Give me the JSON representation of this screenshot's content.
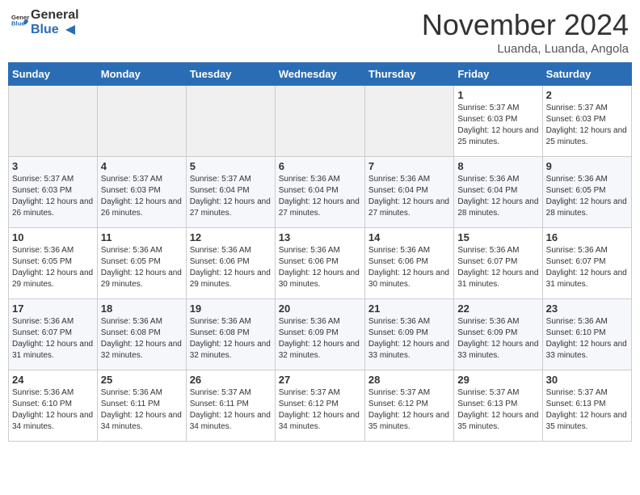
{
  "header": {
    "logo_general": "General",
    "logo_blue": "Blue",
    "month": "November 2024",
    "location": "Luanda, Luanda, Angola"
  },
  "days_of_week": [
    "Sunday",
    "Monday",
    "Tuesday",
    "Wednesday",
    "Thursday",
    "Friday",
    "Saturday"
  ],
  "weeks": [
    [
      {
        "day": "",
        "info": ""
      },
      {
        "day": "",
        "info": ""
      },
      {
        "day": "",
        "info": ""
      },
      {
        "day": "",
        "info": ""
      },
      {
        "day": "",
        "info": ""
      },
      {
        "day": "1",
        "info": "Sunrise: 5:37 AM\nSunset: 6:03 PM\nDaylight: 12 hours and 25 minutes."
      },
      {
        "day": "2",
        "info": "Sunrise: 5:37 AM\nSunset: 6:03 PM\nDaylight: 12 hours and 25 minutes."
      }
    ],
    [
      {
        "day": "3",
        "info": "Sunrise: 5:37 AM\nSunset: 6:03 PM\nDaylight: 12 hours and 26 minutes."
      },
      {
        "day": "4",
        "info": "Sunrise: 5:37 AM\nSunset: 6:03 PM\nDaylight: 12 hours and 26 minutes."
      },
      {
        "day": "5",
        "info": "Sunrise: 5:37 AM\nSunset: 6:04 PM\nDaylight: 12 hours and 27 minutes."
      },
      {
        "day": "6",
        "info": "Sunrise: 5:36 AM\nSunset: 6:04 PM\nDaylight: 12 hours and 27 minutes."
      },
      {
        "day": "7",
        "info": "Sunrise: 5:36 AM\nSunset: 6:04 PM\nDaylight: 12 hours and 27 minutes."
      },
      {
        "day": "8",
        "info": "Sunrise: 5:36 AM\nSunset: 6:04 PM\nDaylight: 12 hours and 28 minutes."
      },
      {
        "day": "9",
        "info": "Sunrise: 5:36 AM\nSunset: 6:05 PM\nDaylight: 12 hours and 28 minutes."
      }
    ],
    [
      {
        "day": "10",
        "info": "Sunrise: 5:36 AM\nSunset: 6:05 PM\nDaylight: 12 hours and 29 minutes."
      },
      {
        "day": "11",
        "info": "Sunrise: 5:36 AM\nSunset: 6:05 PM\nDaylight: 12 hours and 29 minutes."
      },
      {
        "day": "12",
        "info": "Sunrise: 5:36 AM\nSunset: 6:06 PM\nDaylight: 12 hours and 29 minutes."
      },
      {
        "day": "13",
        "info": "Sunrise: 5:36 AM\nSunset: 6:06 PM\nDaylight: 12 hours and 30 minutes."
      },
      {
        "day": "14",
        "info": "Sunrise: 5:36 AM\nSunset: 6:06 PM\nDaylight: 12 hours and 30 minutes."
      },
      {
        "day": "15",
        "info": "Sunrise: 5:36 AM\nSunset: 6:07 PM\nDaylight: 12 hours and 31 minutes."
      },
      {
        "day": "16",
        "info": "Sunrise: 5:36 AM\nSunset: 6:07 PM\nDaylight: 12 hours and 31 minutes."
      }
    ],
    [
      {
        "day": "17",
        "info": "Sunrise: 5:36 AM\nSunset: 6:07 PM\nDaylight: 12 hours and 31 minutes."
      },
      {
        "day": "18",
        "info": "Sunrise: 5:36 AM\nSunset: 6:08 PM\nDaylight: 12 hours and 32 minutes."
      },
      {
        "day": "19",
        "info": "Sunrise: 5:36 AM\nSunset: 6:08 PM\nDaylight: 12 hours and 32 minutes."
      },
      {
        "day": "20",
        "info": "Sunrise: 5:36 AM\nSunset: 6:09 PM\nDaylight: 12 hours and 32 minutes."
      },
      {
        "day": "21",
        "info": "Sunrise: 5:36 AM\nSunset: 6:09 PM\nDaylight: 12 hours and 33 minutes."
      },
      {
        "day": "22",
        "info": "Sunrise: 5:36 AM\nSunset: 6:09 PM\nDaylight: 12 hours and 33 minutes."
      },
      {
        "day": "23",
        "info": "Sunrise: 5:36 AM\nSunset: 6:10 PM\nDaylight: 12 hours and 33 minutes."
      }
    ],
    [
      {
        "day": "24",
        "info": "Sunrise: 5:36 AM\nSunset: 6:10 PM\nDaylight: 12 hours and 34 minutes."
      },
      {
        "day": "25",
        "info": "Sunrise: 5:36 AM\nSunset: 6:11 PM\nDaylight: 12 hours and 34 minutes."
      },
      {
        "day": "26",
        "info": "Sunrise: 5:37 AM\nSunset: 6:11 PM\nDaylight: 12 hours and 34 minutes."
      },
      {
        "day": "27",
        "info": "Sunrise: 5:37 AM\nSunset: 6:12 PM\nDaylight: 12 hours and 34 minutes."
      },
      {
        "day": "28",
        "info": "Sunrise: 5:37 AM\nSunset: 6:12 PM\nDaylight: 12 hours and 35 minutes."
      },
      {
        "day": "29",
        "info": "Sunrise: 5:37 AM\nSunset: 6:13 PM\nDaylight: 12 hours and 35 minutes."
      },
      {
        "day": "30",
        "info": "Sunrise: 5:37 AM\nSunset: 6:13 PM\nDaylight: 12 hours and 35 minutes."
      }
    ]
  ]
}
